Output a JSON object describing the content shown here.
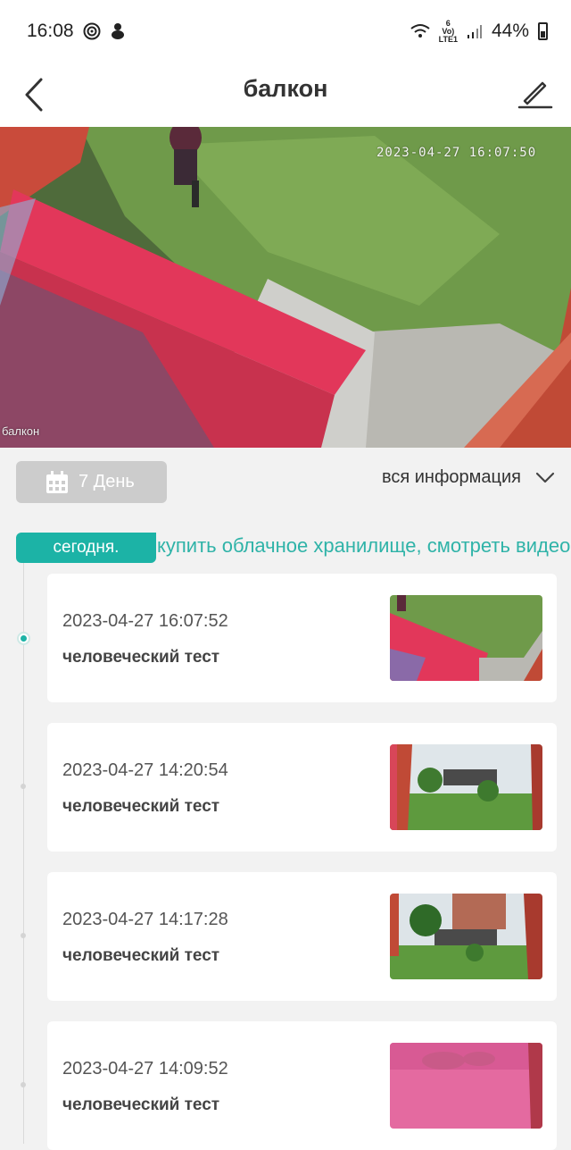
{
  "status_bar": {
    "time": "16:08",
    "network_top": "6",
    "network_volte": "Vo)",
    "network_lte": "LTE1",
    "battery": "44%"
  },
  "header": {
    "title": "балкон",
    "back_icon": "chevron-left-icon",
    "edit_icon": "pencil-icon"
  },
  "video": {
    "timestamp": "2023-04-27 16:07:50",
    "camera_name": "балкон"
  },
  "filter": {
    "days_label": "7 День",
    "info_filter": "вся информация",
    "calendar_icon": "calendar-icon",
    "dropdown_icon": "chevron-down-icon"
  },
  "timeline": {
    "today_label": "сегодня.",
    "cloud_link": "купить облачное хранилище, смотреть видео"
  },
  "events": [
    {
      "time": "2023-04-27 16:07:52",
      "label": "человеческий тест"
    },
    {
      "time": "2023-04-27 14:20:54",
      "label": "человеческий тест"
    },
    {
      "time": "2023-04-27 14:17:28",
      "label": "человеческий тест"
    },
    {
      "time": "2023-04-27 14:09:52",
      "label": "человеческий тест"
    }
  ],
  "colors": {
    "accent": "#1cb3a6",
    "link": "#2fb3a8",
    "day_button": "#cccccc"
  }
}
